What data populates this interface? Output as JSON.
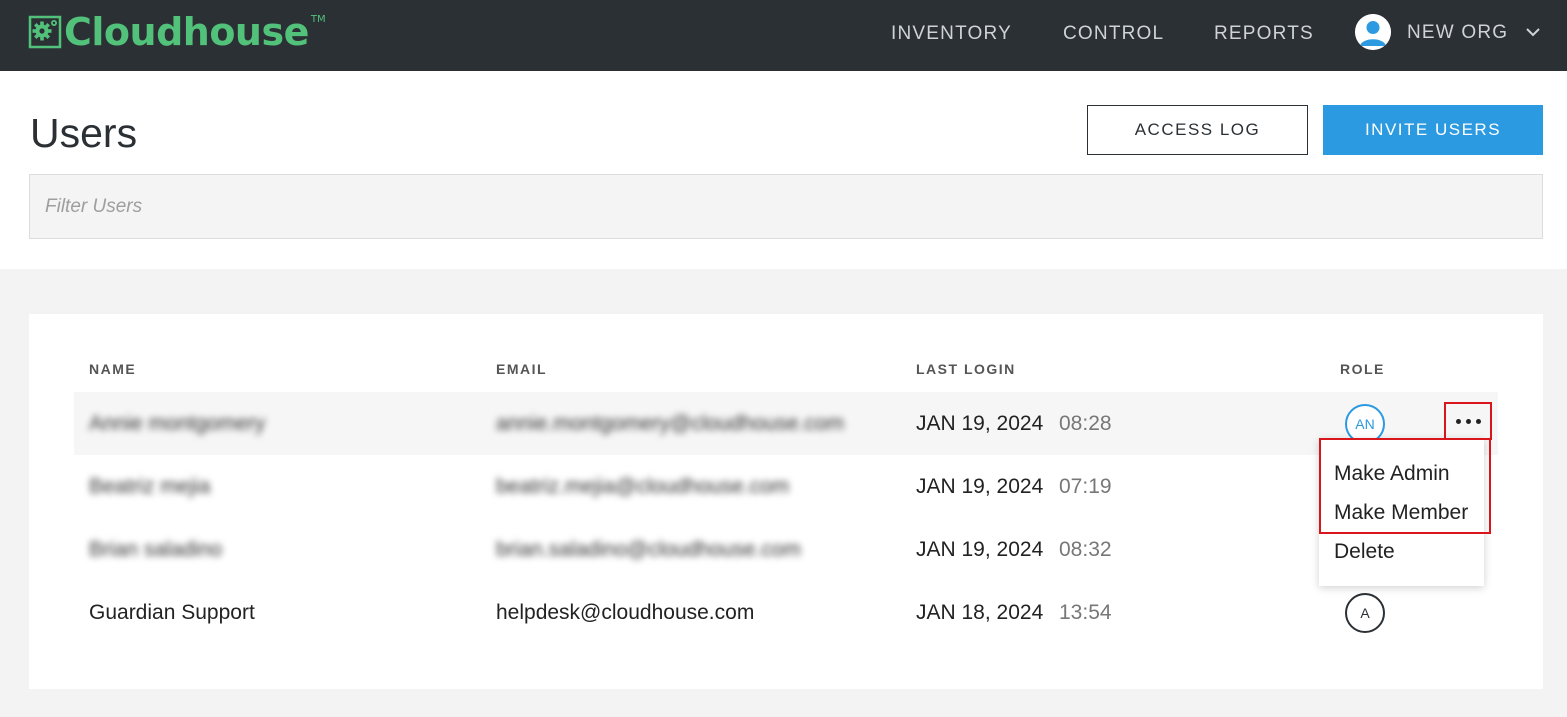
{
  "app": {
    "brand": "Cloudhouse",
    "trademark": "TM",
    "brand_color": "#52c17a",
    "nav": [
      {
        "label": "INVENTORY"
      },
      {
        "label": "CONTROL"
      },
      {
        "label": "REPORTS"
      }
    ],
    "org": {
      "name": "NEW ORG",
      "avatar_icon": "user-avatar-icon",
      "chevron_icon": "chevron-down-icon"
    }
  },
  "page": {
    "title": "Users",
    "access_log_label": "ACCESS LOG",
    "invite_users_label": "INVITE USERS",
    "accent_color": "#2b9ae0"
  },
  "filter": {
    "placeholder": "Filter Users",
    "value": ""
  },
  "table": {
    "columns": {
      "name": "NAME",
      "email": "EMAIL",
      "last_login": "LAST LOGIN",
      "role": "ROLE"
    },
    "rows": [
      {
        "name": "Annie montgomery",
        "email": "annie.montgomery@cloudhouse.com",
        "date": "JAN 19, 2024",
        "time": "08:28",
        "role": "AN",
        "blurred": true
      },
      {
        "name": "Beatriz mejia",
        "email": "beatriz.mejia@cloudhouse.com",
        "date": "JAN 19, 2024",
        "time": "07:19",
        "role": "",
        "blurred": true
      },
      {
        "name": "Brian saladino",
        "email": "brian.saladino@cloudhouse.com",
        "date": "JAN 19, 2024",
        "time": "08:32",
        "role": "",
        "blurred": true
      },
      {
        "name": "Guardian Support",
        "email": "helpdesk@cloudhouse.com",
        "date": "JAN 18, 2024",
        "time": "13:54",
        "role": "A",
        "blurred": false
      }
    ]
  },
  "row_menu": {
    "trigger_icon": "more-horizontal-icon",
    "items": [
      {
        "label": "Make Admin"
      },
      {
        "label": "Make Member"
      },
      {
        "label": "Delete"
      }
    ],
    "highlight_color": "#d8161b"
  }
}
